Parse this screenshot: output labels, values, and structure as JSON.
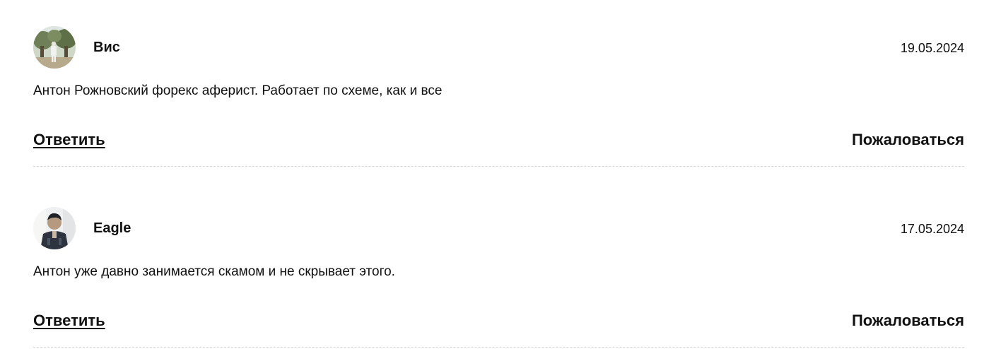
{
  "comments": [
    {
      "author": "Вис",
      "date": "19.05.2024",
      "text": "Антон Рожновский форекс аферист. Работает по схеме, как и все",
      "reply_label": "Ответить",
      "report_label": "Пожаловаться",
      "avatar_icon": "user-photo-avatar"
    },
    {
      "author": "Eagle",
      "date": "17.05.2024",
      "text": "Антон уже давно занимается скамом и не скрывает этого.",
      "reply_label": "Ответить",
      "report_label": "Пожаловаться",
      "avatar_icon": "user-photo-avatar"
    }
  ]
}
